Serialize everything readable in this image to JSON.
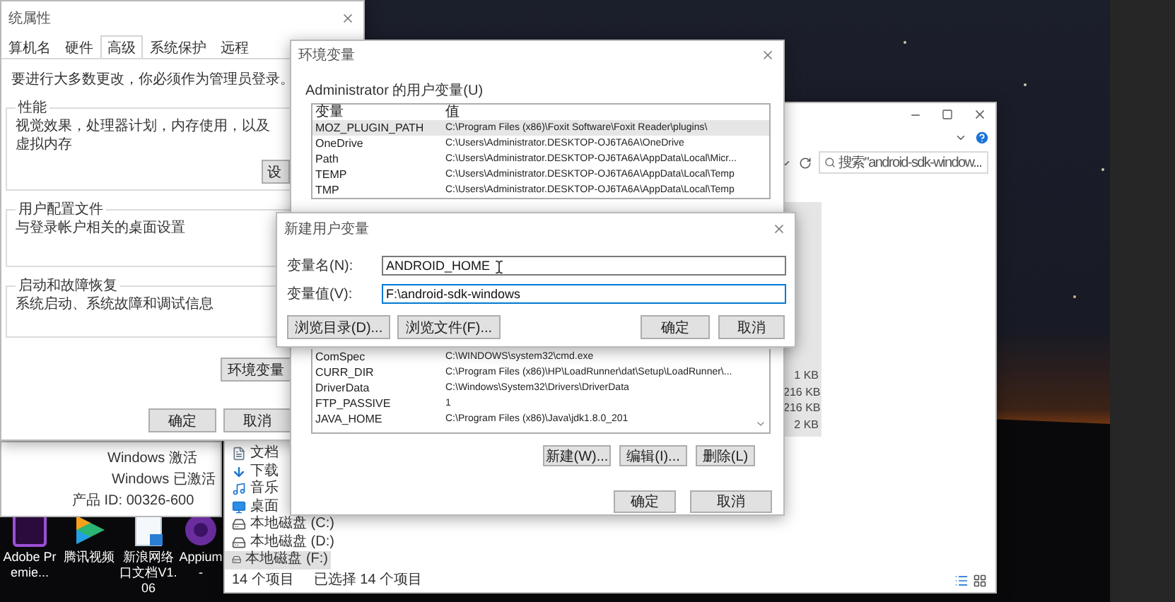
{
  "system_properties": {
    "title": "统属性",
    "tabs": [
      {
        "label": "算机名",
        "selected": false
      },
      {
        "label": "硬件",
        "selected": false
      },
      {
        "label": "高级",
        "selected": true
      },
      {
        "label": "系统保护",
        "selected": false
      },
      {
        "label": "远程",
        "selected": false
      }
    ],
    "note": "要进行大多数更改，你必须作为管理员登录。",
    "groups": [
      {
        "title": "性能",
        "text": "视觉效果，处理器计划，内存使用，以及虚拟内存",
        "button": "设"
      },
      {
        "title": "用户配置文件",
        "text": "与登录帐户相关的桌面设置"
      },
      {
        "title": "启动和故障恢复",
        "text": "系统启动、系统故障和调试信息"
      }
    ],
    "environment_button": "环境变量",
    "buttons": [
      "确定",
      "取消"
    ]
  },
  "activation": {
    "title": "Windows 激活",
    "status": "Windows 已激活",
    "product_id": "产品 ID: 00326-600"
  },
  "desktop_icons": [
    {
      "kind": "premiere",
      "label": "Adobe Premie..."
    },
    {
      "kind": "video",
      "label": "腾讯视频"
    },
    {
      "kind": "document",
      "label": "新浪网络口文档V1.06"
    },
    {
      "kind": "appium",
      "label": "Appium-"
    }
  ],
  "explorer": {
    "search": {
      "placeholder": "搜索\"android-sdk-window..."
    },
    "navigation": [
      {
        "kind": "documents",
        "label": "文档",
        "selected": false
      },
      {
        "kind": "downloads",
        "label": "下载",
        "selected": false
      },
      {
        "kind": "music",
        "label": "音乐",
        "selected": false
      },
      {
        "kind": "desktop",
        "label": "桌面",
        "selected": false
      },
      {
        "kind": "drive",
        "label": "本地磁盘 (C:)",
        "selected": false
      },
      {
        "kind": "drive",
        "label": "本地磁盘 (D:)",
        "selected": false
      },
      {
        "kind": "drive",
        "label": "本地磁盘 (F:)",
        "selected": true
      }
    ],
    "file_sizes": [
      "1 KB",
      "216 KB",
      "216 KB",
      "2 KB"
    ],
    "status_bar": {
      "item_count": "14 个项目",
      "selection": "已选择 14 个项目"
    }
  },
  "environment_variables": {
    "title": "环境变量",
    "user_section": "Administrator 的用户变量(U)",
    "columns": [
      "变量",
      "值"
    ],
    "user_variables": [
      {
        "name": "MOZ_PLUGIN_PATH",
        "value": "C:\\Program Files (x86)\\Foxit Software\\Foxit Reader\\plugins\\",
        "selected": true
      },
      {
        "name": "OneDrive",
        "value": "C:\\Users\\Administrator.DESKTOP-OJ6TA6A\\OneDrive",
        "selected": false
      },
      {
        "name": "Path",
        "value": "C:\\Users\\Administrator.DESKTOP-OJ6TA6A\\AppData\\Local\\Micr...",
        "selected": false
      },
      {
        "name": "TEMP",
        "value": "C:\\Users\\Administrator.DESKTOP-OJ6TA6A\\AppData\\Local\\Temp",
        "selected": false
      },
      {
        "name": "TMP",
        "value": "C:\\Users\\Administrator.DESKTOP-OJ6TA6A\\AppData\\Local\\Temp",
        "selected": false
      }
    ],
    "system_variables": [
      {
        "name": "ComSpec",
        "value": "C:\\WINDOWS\\system32\\cmd.exe",
        "selected": false
      },
      {
        "name": "CURR_DIR",
        "value": "C:\\Program Files (x86)\\HP\\LoadRunner\\dat\\Setup\\LoadRunner\\...",
        "selected": false
      },
      {
        "name": "DriverData",
        "value": "C:\\Windows\\System32\\Drivers\\DriverData",
        "selected": false
      },
      {
        "name": "FTP_PASSIVE",
        "value": "1",
        "selected": false
      },
      {
        "name": "JAVA_HOME",
        "value": "C:\\Program Files (x86)\\Java\\jdk1.8.0_201",
        "selected": false
      }
    ],
    "system_buttons": [
      "新建(W)...",
      "编辑(I)...",
      "删除(L)"
    ],
    "buttons": [
      "确定",
      "取消"
    ]
  },
  "new_variable_dialog": {
    "title": "新建用户变量",
    "fields": [
      {
        "label": "变量名(N):",
        "value": "ANDROID_HOME",
        "focused": false
      },
      {
        "label": "变量值(V):",
        "value": "F:\\android-sdk-windows",
        "focused": true
      }
    ],
    "browse_buttons": [
      "浏览目录(D)...",
      "浏览文件(F)..."
    ],
    "buttons": [
      "确定",
      "取消"
    ]
  }
}
